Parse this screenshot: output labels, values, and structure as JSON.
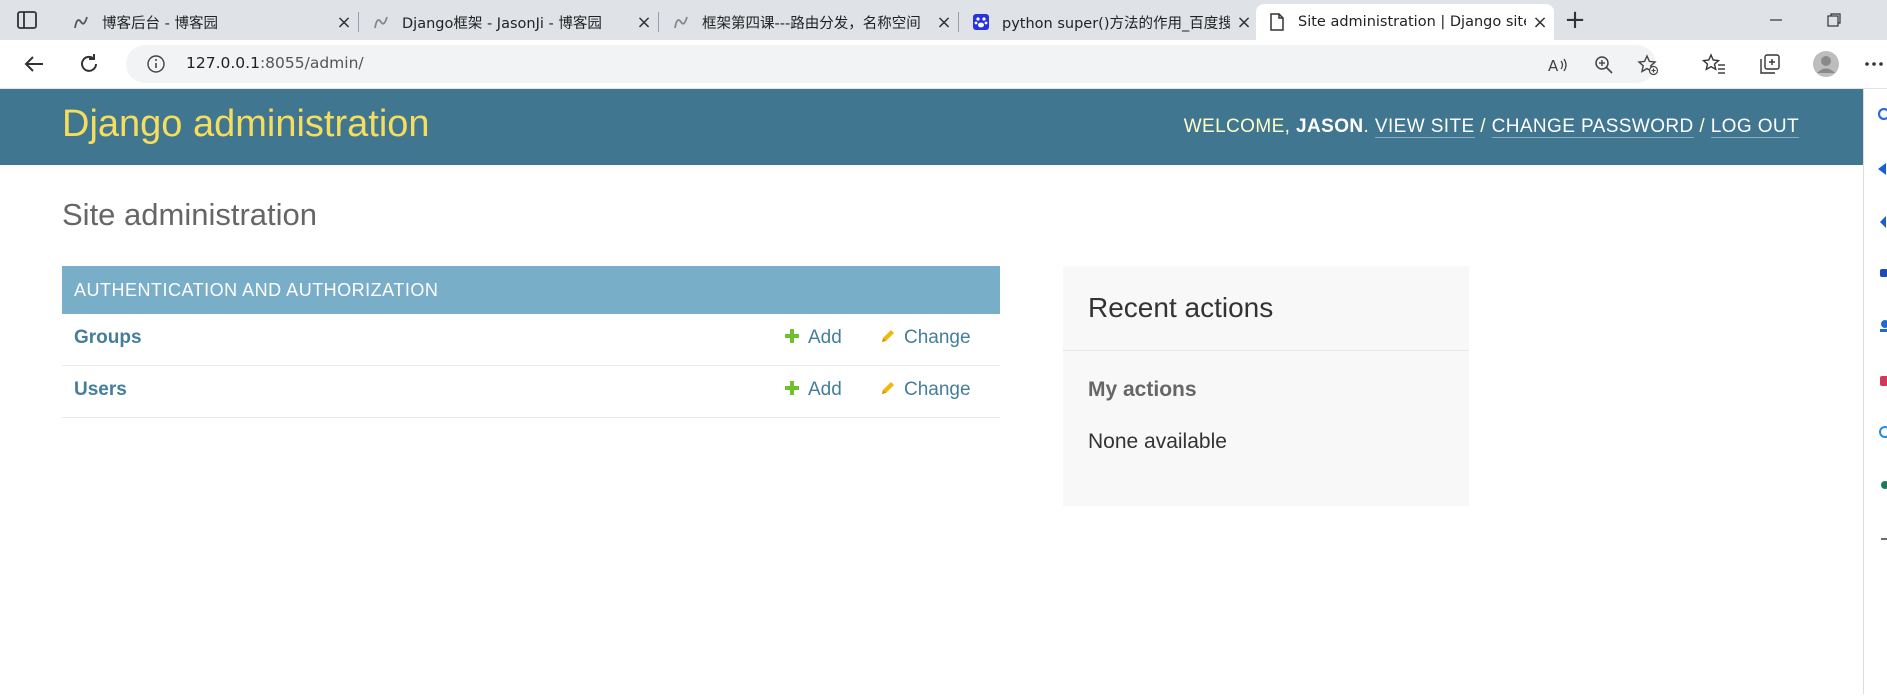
{
  "browser": {
    "tabs": [
      {
        "title": "博客后台 - 博客园",
        "active": false
      },
      {
        "title": "Django框架 - JasonJi - 博客园",
        "active": false
      },
      {
        "title": "框架第四课---路由分发，名称空间",
        "active": false
      },
      {
        "title": "python super()方法的作用_百度搜",
        "active": false
      },
      {
        "title": "Site administration | Django site",
        "active": true
      }
    ],
    "url_host": "127.0.0.1",
    "url_rest": ":8055/admin/"
  },
  "header": {
    "branding": "Django administration",
    "welcome": "WELCOME,",
    "username": "JASON",
    "view_site": "VIEW SITE",
    "change_password": "CHANGE PASSWORD",
    "log_out": "LOG OUT",
    "separator": "/"
  },
  "content": {
    "title": "Site administration",
    "module": {
      "caption": "AUTHENTICATION AND AUTHORIZATION",
      "models": [
        {
          "name": "Groups",
          "add": "Add",
          "change": "Change"
        },
        {
          "name": "Users",
          "add": "Add",
          "change": "Change"
        }
      ]
    },
    "recent_actions": {
      "title": "Recent actions",
      "subtitle": "My actions",
      "empty": "None available"
    }
  },
  "colors": {
    "header_bg": "#417690",
    "branding": "#f5dd5d",
    "module_caption_bg": "#79aec8",
    "link": "#447e9b",
    "add_icon": "#70bf2b",
    "change_icon": "#efb80b"
  }
}
